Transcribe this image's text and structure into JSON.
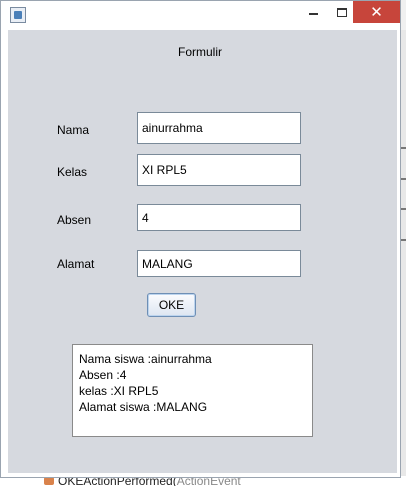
{
  "window": {
    "title": "",
    "controls": {
      "minimize": "minimize",
      "maximize": "maximize",
      "close": "✕"
    }
  },
  "form": {
    "title": "Formulir",
    "fields": {
      "nama": {
        "label": "Nama",
        "value": "ainurrahma"
      },
      "kelas": {
        "label": "Kelas",
        "value": "XI RPL5"
      },
      "absen": {
        "label": "Absen",
        "value": "4"
      },
      "alamat": {
        "label": "Alamat",
        "value": "MALANG"
      }
    },
    "submit_label": "OKE",
    "output_lines": [
      "Nama siswa :ainurrahma",
      "Absen :4",
      "kelas :XI RPL5",
      "Alamat siswa :MALANG"
    ]
  },
  "background": {
    "code_text_main": "OKEActionPerformed(",
    "code_text_type": "ActionEvent"
  },
  "colors": {
    "content_bg": "#d6d9df",
    "close_button": "#c7453b",
    "button_border": "#6e8fb5"
  }
}
